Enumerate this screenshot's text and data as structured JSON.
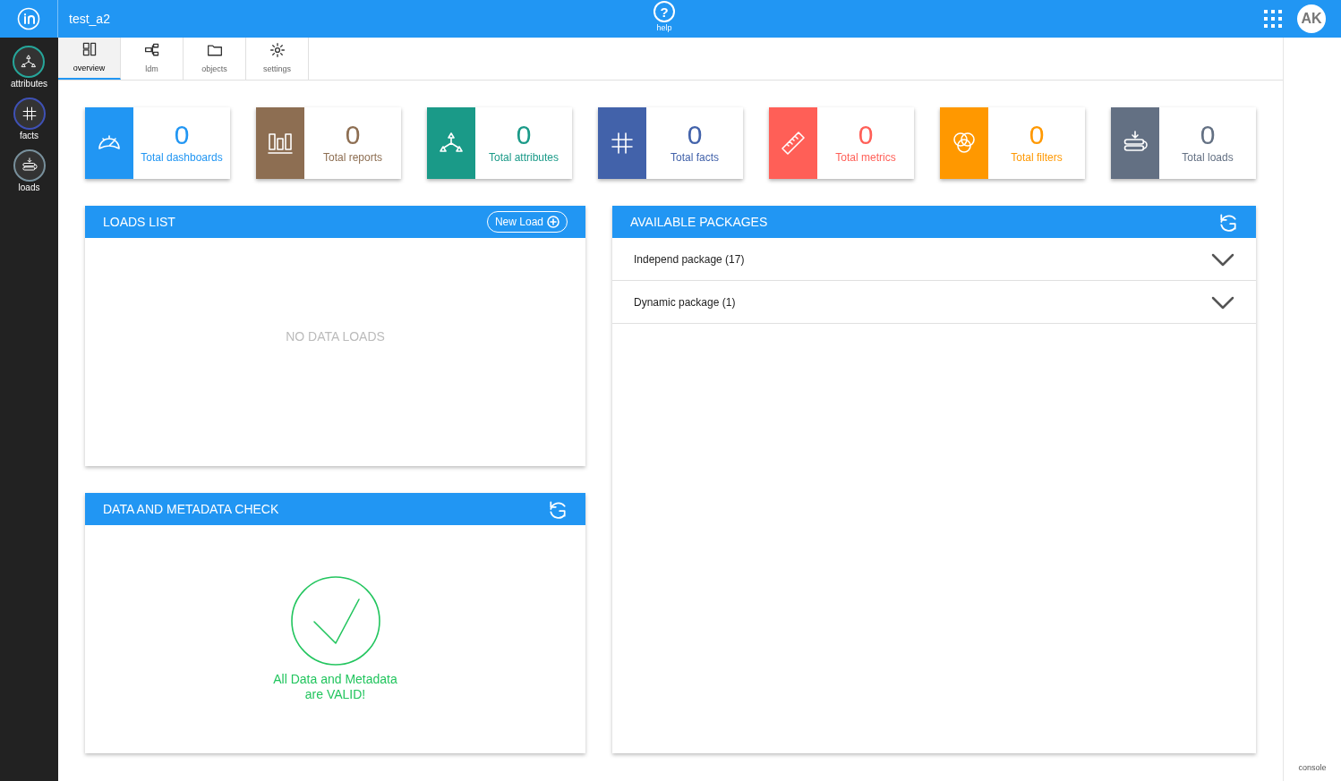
{
  "header": {
    "title": "test_a2",
    "help": {
      "icon": "?",
      "label": "help"
    },
    "avatar": "AK"
  },
  "sidebar": {
    "items": [
      {
        "kind": "attributes",
        "label": "attributes",
        "color": "#26a69a"
      },
      {
        "kind": "facts",
        "label": "facts",
        "color": "#3f51b5"
      },
      {
        "kind": "loads",
        "label": "loads",
        "color": "#78909c"
      }
    ]
  },
  "tabs": [
    {
      "kind": "overview",
      "label": "overview",
      "selected": true
    },
    {
      "kind": "ldm",
      "label": "ldm",
      "selected": false
    },
    {
      "kind": "objects",
      "label": "objects",
      "selected": false
    },
    {
      "kind": "settings",
      "label": "settings",
      "selected": false
    }
  ],
  "stats": [
    {
      "kind": "dashboards",
      "value": "0",
      "label": "Total dashboards",
      "color": "#2196f3"
    },
    {
      "kind": "reports",
      "value": "0",
      "label": "Total reports",
      "color": "#8d6e52"
    },
    {
      "kind": "attributes",
      "value": "0",
      "label": "Total attributes",
      "color": "#1a9a88"
    },
    {
      "kind": "facts",
      "value": "0",
      "label": "Total facts",
      "color": "#4262aa"
    },
    {
      "kind": "metrics",
      "value": "0",
      "label": "Total metrics",
      "color": "#ff5f57"
    },
    {
      "kind": "filters",
      "value": "0",
      "label": "Total filters",
      "color": "#ff9800"
    },
    {
      "kind": "loads",
      "value": "0",
      "label": "Total loads",
      "color": "#637083"
    }
  ],
  "loads_list": {
    "title": "LOADS LIST",
    "button": "New Load",
    "empty": "NO DATA LOADS"
  },
  "data_check": {
    "title": "DATA AND METADATA CHECK",
    "message": "All Data and Metadata\nare VALID!"
  },
  "packages": {
    "title": "AVAILABLE PACKAGES",
    "items": [
      {
        "label": "Independ package (17)",
        "expanded": false
      },
      {
        "label": "Dynamic package (1)",
        "expanded": false
      }
    ]
  },
  "console": "console"
}
